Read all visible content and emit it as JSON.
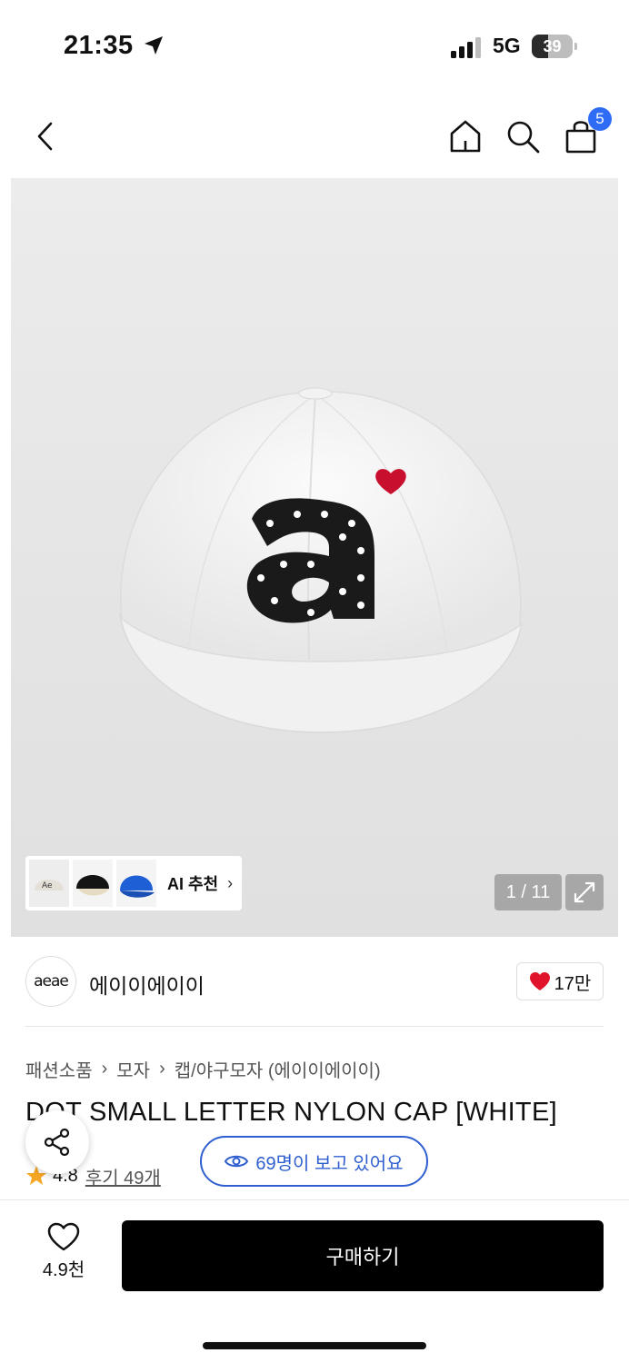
{
  "status_bar": {
    "time": "21:35",
    "network": "5G",
    "battery_percent": "39",
    "battery_level": 0.39,
    "icons": [
      "location-arrow-icon",
      "signal-icon",
      "battery-icon"
    ]
  },
  "nav": {
    "back_icon": "chevron-left-icon",
    "home_icon": "home-icon",
    "search_icon": "search-icon",
    "cart_icon": "shopping-bag-icon",
    "cart_count": "5"
  },
  "gallery": {
    "ai_label": "AI 추천",
    "page_counter": "1 / 11",
    "expand_icon": "expand-icon",
    "colors": {
      "cap": "#f4f4f4",
      "letter": "#1a1a1a",
      "heart": "#c8102e"
    }
  },
  "brand": {
    "logo_text": "aeae",
    "name": "에이이에이이",
    "like_count": "17만",
    "like_color": "#e0152b"
  },
  "breadcrumb": [
    "패션소품",
    "모자",
    "캡/야구모자 (에이이에이이)"
  ],
  "product": {
    "title": "DOT SMALL LETTER NYLON CAP [WHITE]",
    "rating": "4.8",
    "review_link": "후기 49개",
    "viewers": "69명이 보고 있어요",
    "star_color": "#f5a623",
    "accent_color": "#2f5fd0"
  },
  "bottom_bar": {
    "wish_count": "4.9천",
    "buy_label": "구매하기"
  }
}
